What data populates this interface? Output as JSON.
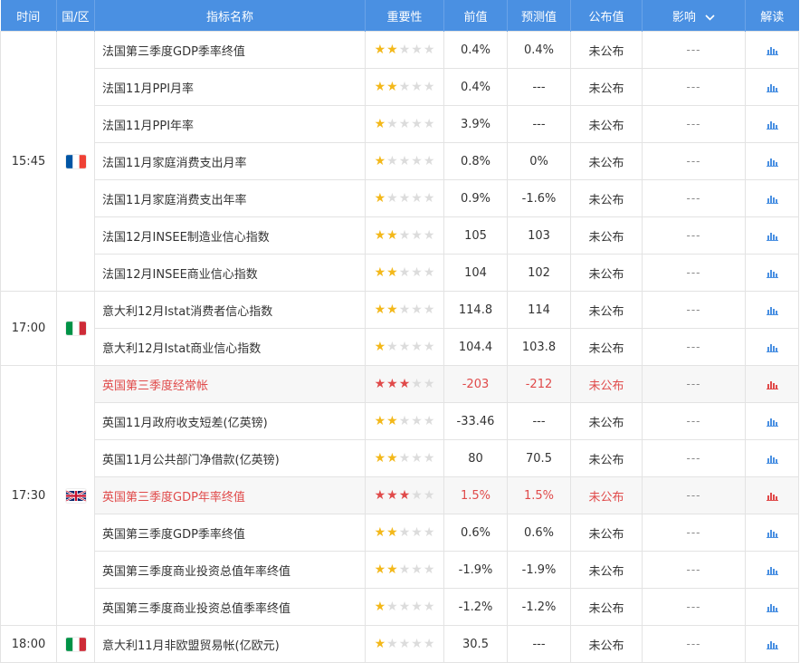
{
  "header": {
    "time": "时间",
    "country": "国/区",
    "name": "指标名称",
    "importance": "重要性",
    "prev": "前值",
    "forecast": "预测值",
    "actual": "公布值",
    "impact": "影响",
    "analysis": "解读"
  },
  "groups": [
    {
      "time": "15:45",
      "flag": "fr",
      "rows": [
        {
          "name": "法国第三季度GDP季率终值",
          "stars": 2,
          "prev": "0.4%",
          "forecast": "0.4%",
          "actual": "未公布",
          "impact": "---",
          "hl": false
        },
        {
          "name": "法国11月PPI月率",
          "stars": 2,
          "prev": "0.4%",
          "forecast": "---",
          "actual": "未公布",
          "impact": "---",
          "hl": false
        },
        {
          "name": "法国11月PPI年率",
          "stars": 1,
          "prev": "3.9%",
          "forecast": "---",
          "actual": "未公布",
          "impact": "---",
          "hl": false
        },
        {
          "name": "法国11月家庭消费支出月率",
          "stars": 1,
          "prev": "0.8%",
          "forecast": "0%",
          "actual": "未公布",
          "impact": "---",
          "hl": false
        },
        {
          "name": "法国11月家庭消费支出年率",
          "stars": 1,
          "prev": "0.9%",
          "forecast": "-1.6%",
          "actual": "未公布",
          "impact": "---",
          "hl": false
        },
        {
          "name": "法国12月INSEE制造业信心指数",
          "stars": 2,
          "prev": "105",
          "forecast": "103",
          "actual": "未公布",
          "impact": "---",
          "hl": false
        },
        {
          "name": "法国12月INSEE商业信心指数",
          "stars": 2,
          "prev": "104",
          "forecast": "102",
          "actual": "未公布",
          "impact": "---",
          "hl": false
        }
      ]
    },
    {
      "time": "17:00",
      "flag": "it",
      "rows": [
        {
          "name": "意大利12月Istat消费者信心指数",
          "stars": 2,
          "prev": "114.8",
          "forecast": "114",
          "actual": "未公布",
          "impact": "---",
          "hl": false
        },
        {
          "name": "意大利12月Istat商业信心指数",
          "stars": 1,
          "prev": "104.4",
          "forecast": "103.8",
          "actual": "未公布",
          "impact": "---",
          "hl": false
        }
      ]
    },
    {
      "time": "17:30",
      "flag": "gb",
      "rows": [
        {
          "name": "英国第三季度经常帐",
          "stars": 3,
          "prev": "-203",
          "forecast": "-212",
          "actual": "未公布",
          "impact": "---",
          "hl": true
        },
        {
          "name": "英国11月政府收支短差(亿英镑)",
          "stars": 2,
          "prev": "-33.46",
          "forecast": "---",
          "actual": "未公布",
          "impact": "---",
          "hl": false
        },
        {
          "name": "英国11月公共部门净借款(亿英镑)",
          "stars": 2,
          "prev": "80",
          "forecast": "70.5",
          "actual": "未公布",
          "impact": "---",
          "hl": false
        },
        {
          "name": "英国第三季度GDP年率终值",
          "stars": 3,
          "prev": "1.5%",
          "forecast": "1.5%",
          "actual": "未公布",
          "impact": "---",
          "hl": true
        },
        {
          "name": "英国第三季度GDP季率终值",
          "stars": 2,
          "prev": "0.6%",
          "forecast": "0.6%",
          "actual": "未公布",
          "impact": "---",
          "hl": false
        },
        {
          "name": "英国第三季度商业投资总值年率终值",
          "stars": 2,
          "prev": "-1.9%",
          "forecast": "-1.9%",
          "actual": "未公布",
          "impact": "---",
          "hl": false
        },
        {
          "name": "英国第三季度商业投资总值季率终值",
          "stars": 1,
          "prev": "-1.2%",
          "forecast": "-1.2%",
          "actual": "未公布",
          "impact": "---",
          "hl": false
        }
      ]
    },
    {
      "time": "18:00",
      "flag": "it",
      "rows": [
        {
          "name": "意大利11月非欧盟贸易帐(亿欧元)",
          "stars": 1,
          "prev": "30.5",
          "forecast": "---",
          "actual": "未公布",
          "impact": "---",
          "hl": false
        }
      ]
    }
  ],
  "colors": {
    "header": "#4a90e2",
    "star": "#f3b81a",
    "important": "#e04a4a",
    "chart_icon": "#4a90e2"
  },
  "icons": {
    "impact_toggle": "chevron-down-icon",
    "analysis": "bar-chart-icon"
  }
}
